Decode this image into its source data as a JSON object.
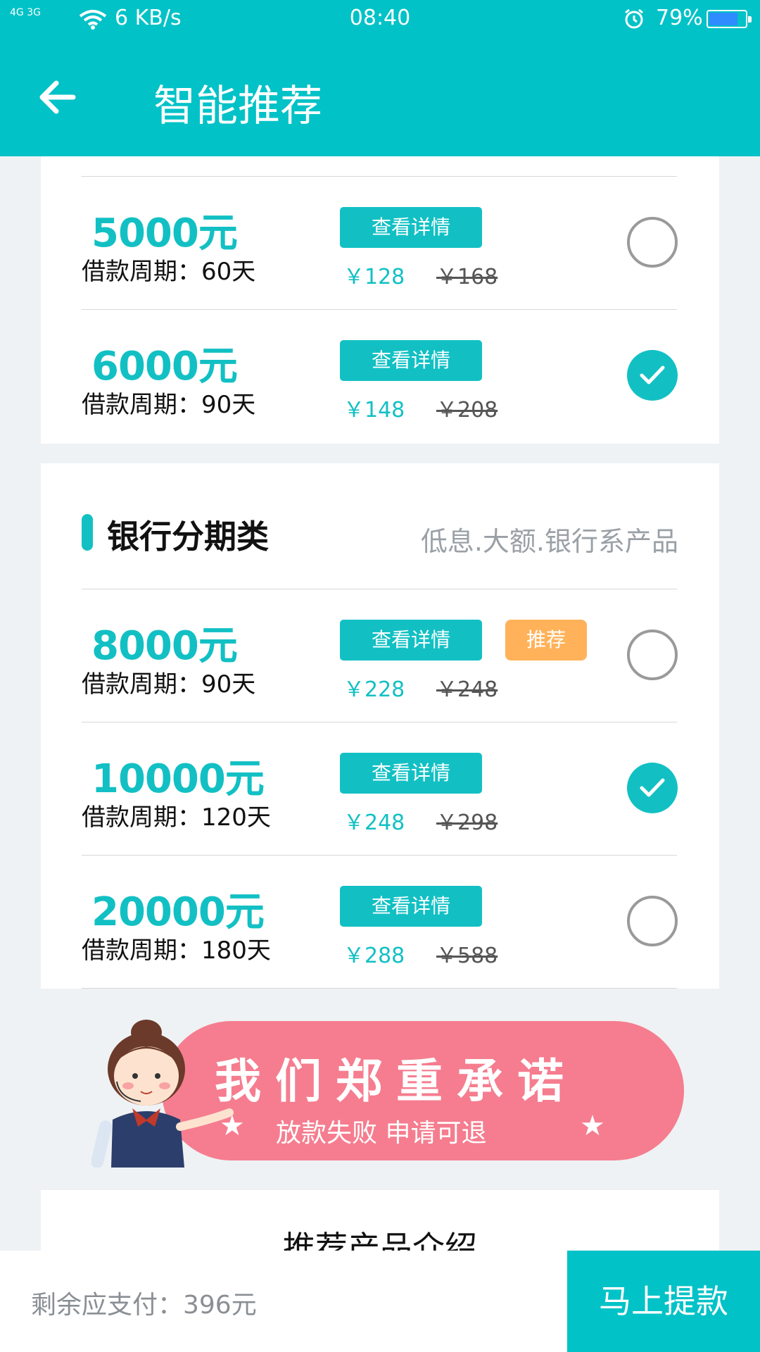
{
  "status_bar": {
    "signal": "4G 3G",
    "net_speed": "6 KB/s",
    "time": "08:40",
    "battery": "79%",
    "battery_level": 0.79
  },
  "header": {
    "title": "智能推荐",
    "back_icon": "arrow-left-icon"
  },
  "colors": {
    "accent": "#00c2c7",
    "tag": "#ffb259",
    "banner": "#f57d8f"
  },
  "loan_rows_top": [
    {
      "amount": "5000元",
      "period": "借款周期：60天",
      "button": "查看详情",
      "price": "￥128",
      "orig_price": "￥168",
      "selected": false
    },
    {
      "amount": "6000元",
      "period": "借款周期：90天",
      "button": "查看详情",
      "price": "￥148",
      "orig_price": "￥208",
      "selected": true
    }
  ],
  "bank_section": {
    "title": "银行分期类",
    "subtitle": "低息.大额.银行系产品",
    "rows": [
      {
        "amount": "8000元",
        "period": "借款周期：90天",
        "button": "查看详情",
        "tag": "推荐",
        "price": "￥228",
        "orig_price": "￥248",
        "selected": false
      },
      {
        "amount": "10000元",
        "period": "借款周期：120天",
        "button": "查看详情",
        "price": "￥248",
        "orig_price": "￥298",
        "selected": true
      },
      {
        "amount": "20000元",
        "period": "借款周期：180天",
        "button": "查看详情",
        "price": "￥288",
        "orig_price": "￥588",
        "selected": false
      }
    ]
  },
  "promise_banner": {
    "headline": "我们郑重承诺",
    "subline": "放款失败  申请可退",
    "star": "★"
  },
  "intro": {
    "title": "推荐产品介绍"
  },
  "footer": {
    "remaining": "剩余应支付：396元",
    "withdraw": "马上提款"
  }
}
